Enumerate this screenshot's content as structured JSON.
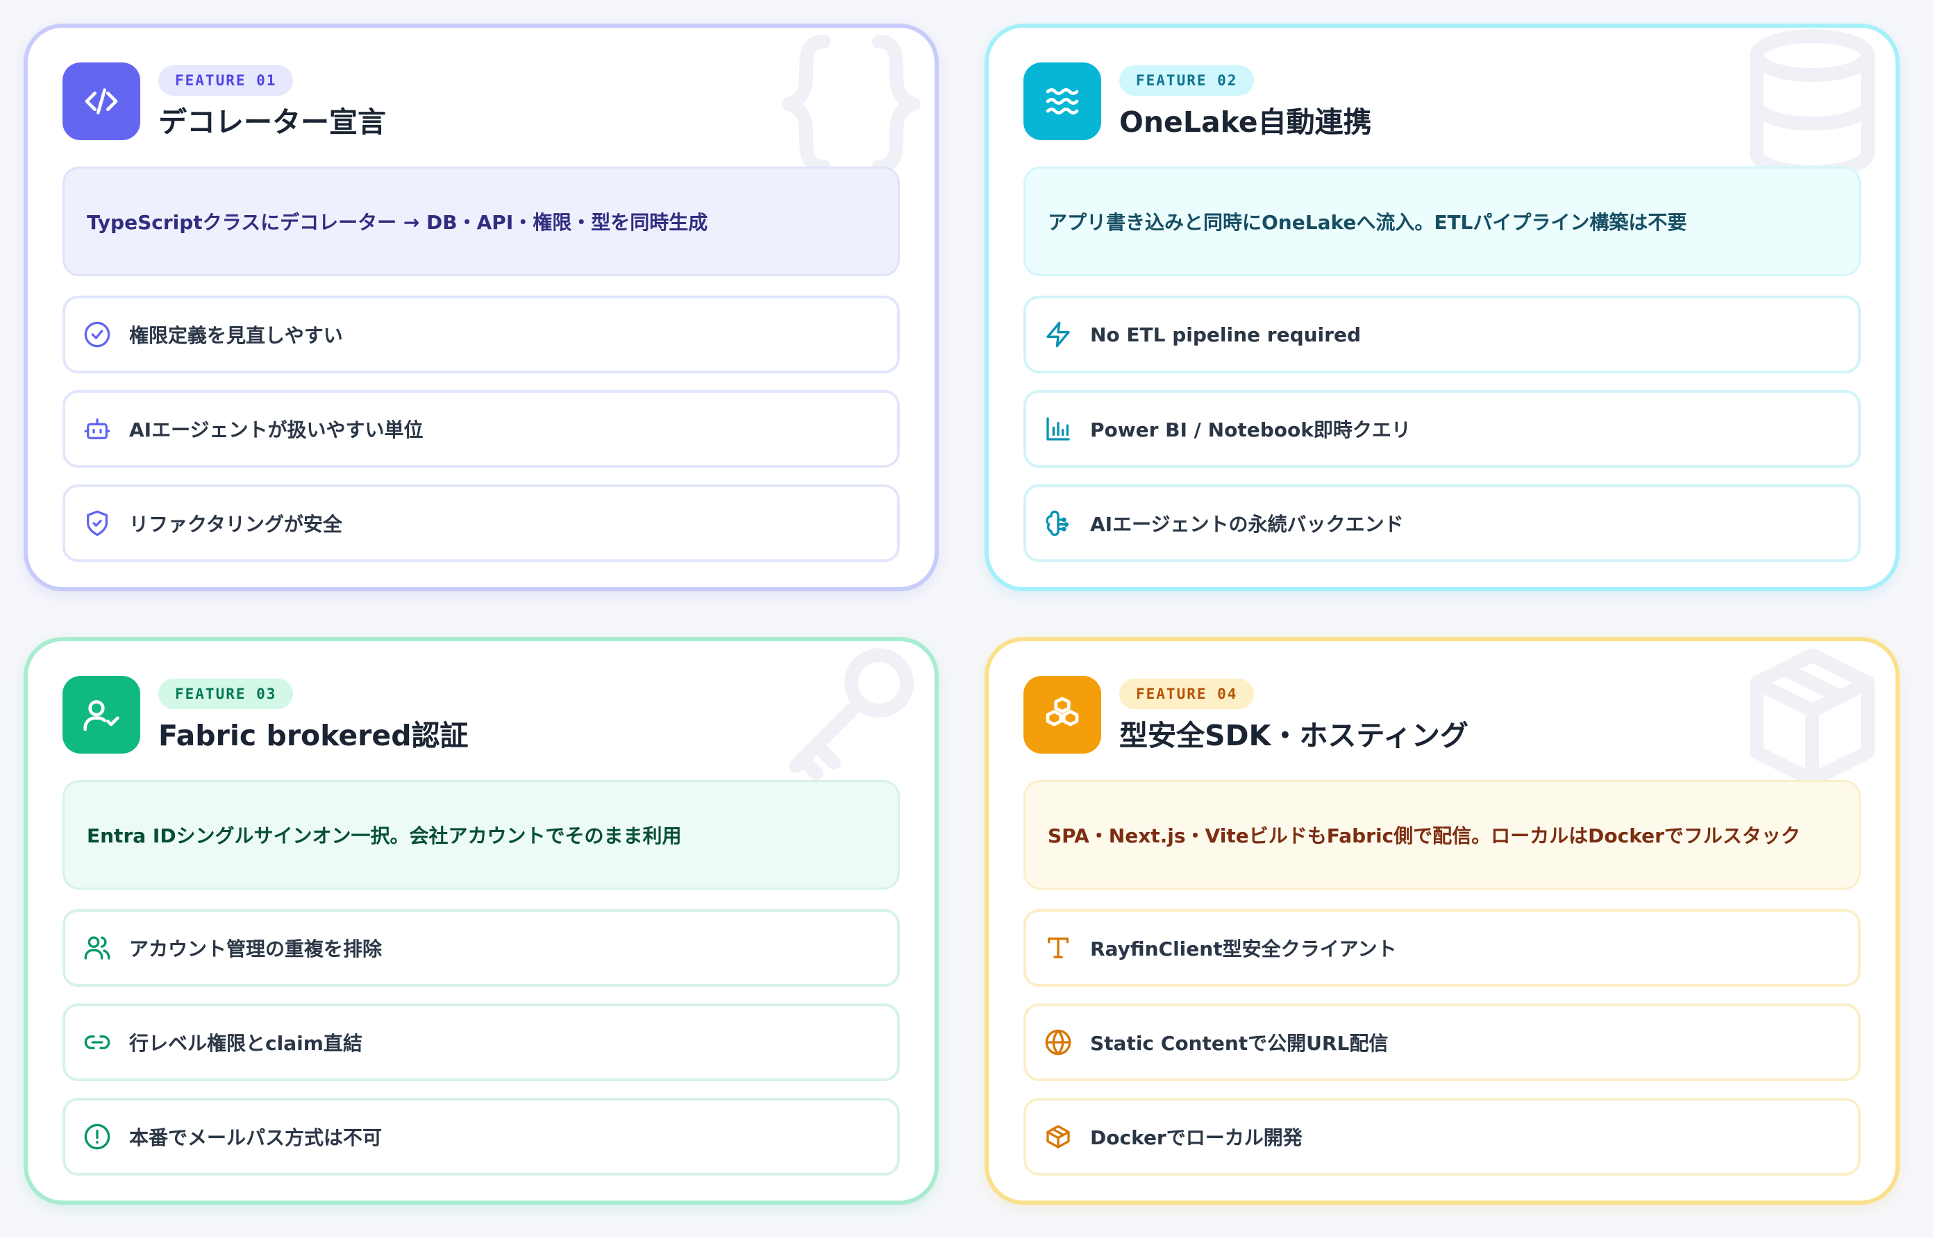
{
  "cards": [
    {
      "badge": "FEATURE 01",
      "title": "デコレーター宣言",
      "icon": "code-icon",
      "summary": "TypeScriptクラスにデコレーター → DB・API・権限・型を同時生成",
      "items": [
        {
          "icon": "check-circle-icon",
          "label": "権限定義を見直しやすい"
        },
        {
          "icon": "bot-icon",
          "label": "AIエージェントが扱いやすい単位"
        },
        {
          "icon": "shield-check-icon",
          "label": "リファクタリングが安全"
        }
      ]
    },
    {
      "badge": "FEATURE 02",
      "title": "OneLake自動連携",
      "icon": "waves-icon",
      "summary": "アプリ書き込みと同時にOneLakeへ流入。ETLパイプライン構築は不要",
      "items": [
        {
          "icon": "zap-icon",
          "label": "No ETL pipeline required"
        },
        {
          "icon": "bar-chart-icon",
          "label": "Power BI / Notebook即時クエリ"
        },
        {
          "icon": "brain-circuit-icon",
          "label": "AIエージェントの永続バックエンド"
        }
      ]
    },
    {
      "badge": "FEATURE 03",
      "title": "Fabric brokered認証",
      "icon": "user-check-icon",
      "summary": "Entra IDシングルサインオン一択。会社アカウントでそのまま利用",
      "items": [
        {
          "icon": "users-icon",
          "label": "アカウント管理の重複を排除"
        },
        {
          "icon": "link-icon",
          "label": "行レベル権限とclaim直結"
        },
        {
          "icon": "alert-circle-icon",
          "label": "本番でメールパス方式は不可"
        }
      ]
    },
    {
      "badge": "FEATURE 04",
      "title": "型安全SDK・ホスティング",
      "icon": "boxes-icon",
      "summary": "SPA・Next.js・ViteビルドもFabric側で配信。ローカルはDockerでフルスタック",
      "items": [
        {
          "icon": "type-icon",
          "label": "RayfinClient型安全クライアント"
        },
        {
          "icon": "globe-icon",
          "label": "Static Contentで公開URL配信"
        },
        {
          "icon": "package-icon",
          "label": "Dockerでローカル開発"
        }
      ]
    }
  ]
}
